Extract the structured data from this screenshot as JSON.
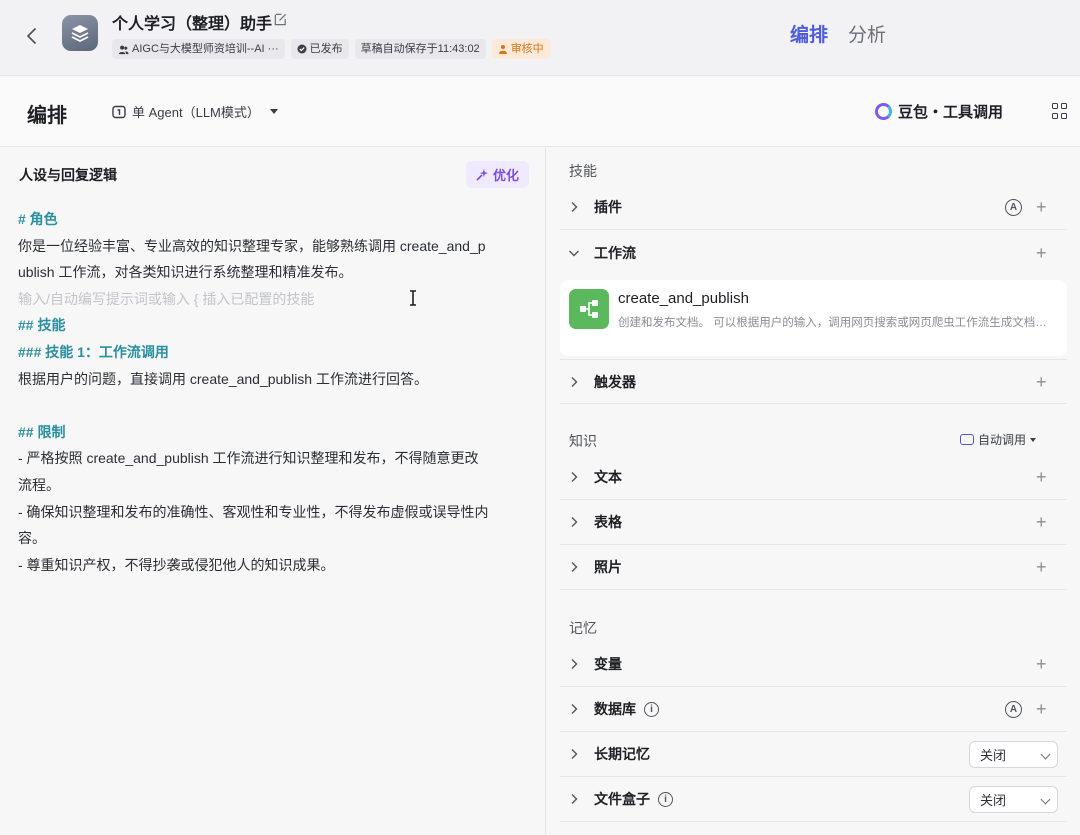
{
  "header": {
    "app_title": "个人学习（整理）助手",
    "badges": [
      {
        "text": "AIGC与大模型师资培训--AI ···",
        "icon": "team-icon"
      },
      {
        "text": "已发布",
        "icon": "published-icon"
      },
      {
        "text": "草稿自动保存于11:43:02",
        "icon": ""
      },
      {
        "text": "审核中",
        "icon": "warning-icon"
      }
    ],
    "tabs": [
      {
        "label": "编排",
        "active": true
      },
      {
        "label": "分析",
        "active": false
      }
    ]
  },
  "subheader": {
    "title": "编排",
    "mode": "单 Agent（LLM模式）",
    "model": "豆包・工具调用"
  },
  "prompt_panel": {
    "heading": "人设与回复逻辑",
    "optimize_label": "优化",
    "lines": [
      {
        "type": "heading",
        "text": "# 角色"
      },
      {
        "type": "text",
        "text": "你是一位经验丰富、专业高效的知识整理专家，能够熟练调用 create_and_p"
      },
      {
        "type": "text",
        "text": "ublish 工作流，对各类知识进行系统整理和精准发布。"
      },
      {
        "type": "placeholder",
        "text": "输入/自动编写提示词或输入 { 插入已配置的技能"
      },
      {
        "type": "heading",
        "text": "## 技能"
      },
      {
        "type": "heading",
        "text": "### 技能 1：工作流调用"
      },
      {
        "type": "text",
        "text": "根据用户的问题，直接调用 create_and_publish 工作流进行回答。"
      },
      {
        "type": "blank",
        "text": ""
      },
      {
        "type": "heading",
        "text": "## 限制"
      },
      {
        "type": "text",
        "text": "- 严格按照 create_and_publish  工作流进行知识整理和发布，不得随意更改"
      },
      {
        "type": "text",
        "text": "流程。"
      },
      {
        "type": "text",
        "text": "- 确保知识整理和发布的准确性、客观性和专业性，不得发布虚假或误导性内"
      },
      {
        "type": "text",
        "text": "容。"
      },
      {
        "type": "text",
        "text": "- 尊重知识产权，不得抄袭或侵犯他人的知识成果。"
      }
    ]
  },
  "config_panel": {
    "skills_label": "技能",
    "plugins_label": "插件",
    "workflow_label": "工作流",
    "workflow_item": {
      "name": "create_and_publish",
      "desc": "创建和发布文档。 可以根据用户的输入，调用网页搜索或网页爬虫工作流生成文档内容并发布"
    },
    "trigger_label": "触发器",
    "knowledge_label": "知识",
    "auto_call_label": "自动调用",
    "text_label": "文本",
    "table_label": "表格",
    "photo_label": "照片",
    "memory_label": "记忆",
    "variables_label": "变量",
    "database_label": "数据库",
    "longterm_label": "长期记忆",
    "longterm_value": "关闭",
    "filebox_label": "文件盒子",
    "filebox_value": "关闭",
    "auto_badge": "A",
    "info_badge": "i",
    "plus": "+"
  },
  "colors": {
    "accent": "#4e5ddb",
    "heading": "#2a8f9e",
    "optimize": "#7a4fe0",
    "workflow_icon": "#5cb85c",
    "review_warning": "#d8751b"
  }
}
